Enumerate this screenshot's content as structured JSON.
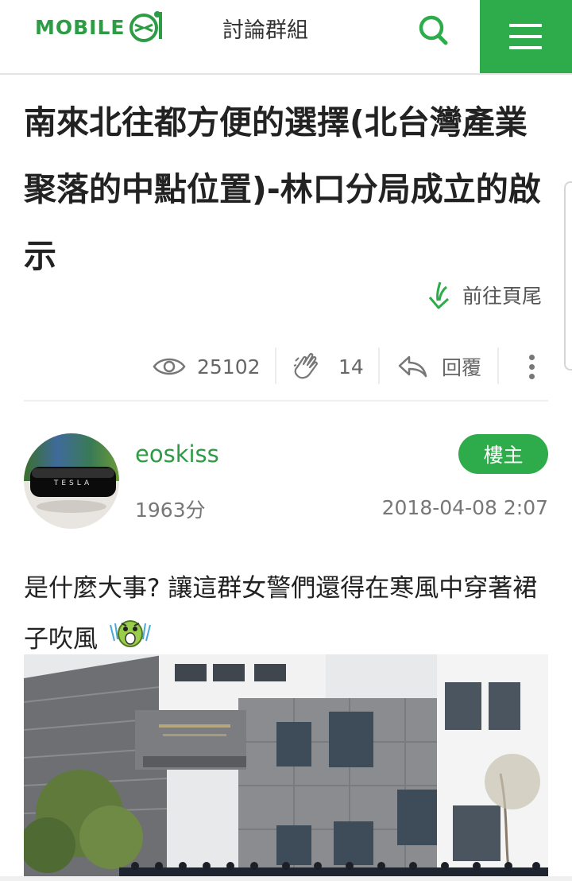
{
  "header": {
    "logo_text": "MOBILE",
    "section_title": "討論群組",
    "icons": [
      "search-icon",
      "menu-icon"
    ],
    "accent_color": "#2eab4a"
  },
  "thread": {
    "title": "南來北往都方便的選擇(北台灣產業聚落的中點位置)-林口分局成立的啟示",
    "go_to_bottom_label": "前往頁尾",
    "stats": {
      "views": "25102",
      "likes": "14",
      "reply_label": "回覆"
    }
  },
  "post": {
    "author": "eoskiss",
    "points": "1963分",
    "role_badge": "樓主",
    "date": "2018-04-08 2:07",
    "content_text": "是什麼大事? 讓這群女警們還得在寒風中穿著裙子吹風",
    "avatar_text": "TESLA"
  }
}
